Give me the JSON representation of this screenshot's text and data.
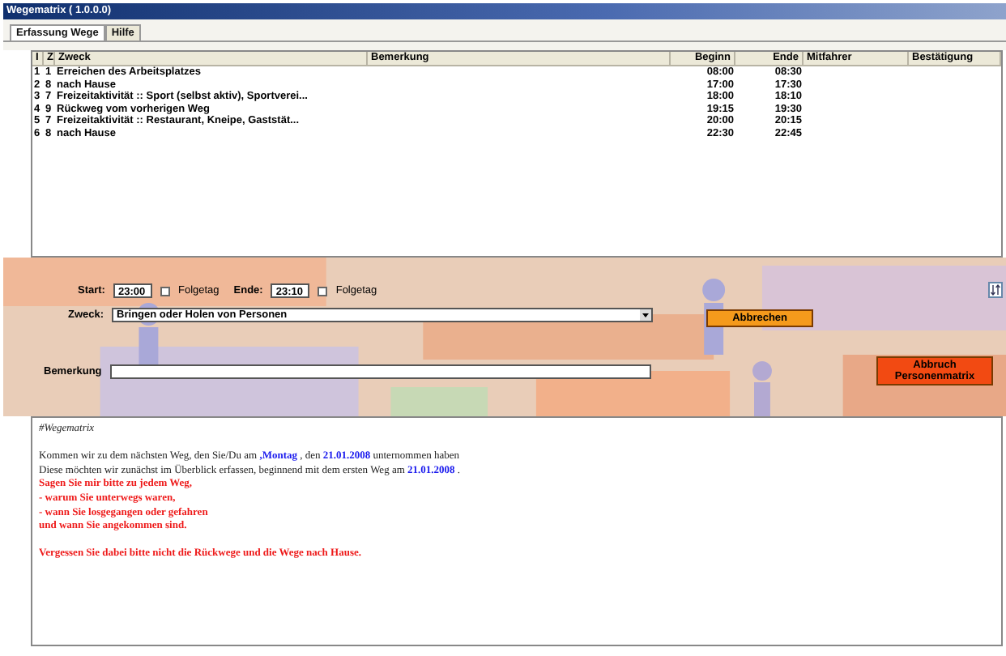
{
  "window": {
    "title": "Wegematrix ( 1.0.0.0)"
  },
  "tabs": [
    {
      "label": "Erfassung Wege",
      "selected": true
    },
    {
      "label": "Hilfe",
      "selected": false
    }
  ],
  "table": {
    "columns": [
      "I",
      "Z",
      "Zweck",
      "Bemerkung",
      "Beginn",
      "Ende",
      "Mitfahrer",
      "Bestätigung"
    ],
    "rows": [
      [
        "1",
        "1",
        "Erreichen des Arbeitsplatzes",
        "",
        "08:00",
        "08:30",
        "",
        ""
      ],
      [
        "2",
        "8",
        "nach Hause",
        "",
        "17:00",
        "17:30",
        "",
        ""
      ],
      [
        "3",
        "7",
        "Freizeitaktivität :: Sport (selbst aktiv), Sportverei...",
        "",
        "18:00",
        "18:10",
        "",
        ""
      ],
      [
        "4",
        "9",
        "Rückweg vom vorherigen Weg",
        "",
        "19:15",
        "19:30",
        "",
        ""
      ],
      [
        "5",
        "7",
        "Freizeitaktivität :: Restaurant, Kneipe, Gaststät...",
        "",
        "20:00",
        "20:15",
        "",
        ""
      ],
      [
        "6",
        "8",
        "nach Hause",
        "",
        "22:30",
        "22:45",
        "",
        ""
      ]
    ]
  },
  "form": {
    "start": {
      "label": "Start:",
      "value": "23:00",
      "next_day": {
        "label": "Folgetag",
        "checked": false
      }
    },
    "end": {
      "label": "Ende:",
      "value": "23:10",
      "next_day": {
        "label": "Folgetag",
        "checked": false
      }
    },
    "purpose": {
      "label": "Zweck:",
      "value": "Bringen oder Holen von Personen"
    },
    "cancel_button": "Abbrechen",
    "remark": {
      "label": "Bemerkung"
    },
    "abort_button": "Abbruch Personenmatrix"
  },
  "text_panel": {
    "lines": [
      {
        "spaced": false,
        "segments": [
          {
            "kind": "heading",
            "text": "#Wegematrix"
          }
        ]
      },
      {
        "spaced": true,
        "segments": [
          {
            "kind": "normal",
            "text": "Kommen wir zu dem nächsten Weg, den Sie/Du am "
          },
          {
            "kind": "highlight",
            "text": ",Montag"
          },
          {
            "kind": "normal",
            "text": " , den "
          },
          {
            "kind": "highlight",
            "text": "21.01.2008"
          },
          {
            "kind": "normal",
            "text": " unternommen haben"
          }
        ]
      },
      {
        "spaced": false,
        "segments": [
          {
            "kind": "normal",
            "text": " Diese möchten wir zunächst im Überblick erfassen, beginnend mit dem ersten Weg am "
          },
          {
            "kind": "highlight",
            "text": "21.01.2008"
          },
          {
            "kind": "normal",
            "text": " ."
          }
        ]
      },
      {
        "spaced": false,
        "segments": [
          {
            "kind": "warning",
            "text": "Sagen Sie mir bitte zu jedem Weg,"
          }
        ]
      },
      {
        "spaced": false,
        "segments": [
          {
            "kind": "warning",
            "text": "- warum Sie unterwegs waren,"
          }
        ]
      },
      {
        "spaced": false,
        "segments": [
          {
            "kind": "warning",
            "text": "- wann Sie losgegangen oder gefahren"
          }
        ]
      },
      {
        "spaced": false,
        "segments": [
          {
            "kind": "warning",
            "text": "und wann Sie angekommen sind."
          }
        ]
      },
      {
        "spaced": true,
        "segments": [
          {
            "kind": "warning",
            "text": "Vergessen Sie dabei bitte nicht die Rückwege und die Wege nach Hause."
          }
        ]
      }
    ]
  }
}
